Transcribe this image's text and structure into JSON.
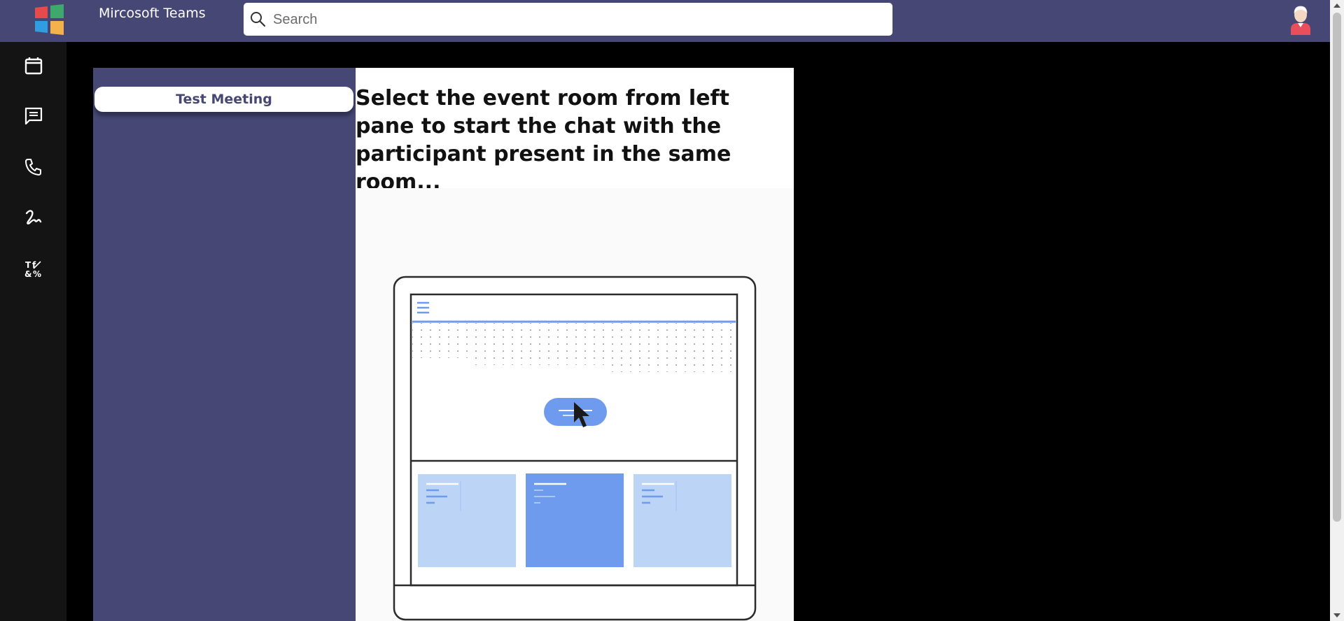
{
  "app": {
    "title": "Mircosoft Teams"
  },
  "search": {
    "placeholder": "Search",
    "value": ""
  },
  "rail": {
    "items": [
      {
        "icon": "calendar-icon"
      },
      {
        "icon": "chat-icon"
      },
      {
        "icon": "phone-icon"
      },
      {
        "icon": "signature-icon"
      },
      {
        "icon": "text-format-icon"
      }
    ]
  },
  "events": {
    "items": [
      {
        "label": "Test Meeting"
      }
    ]
  },
  "main": {
    "instruction": "Select the event room from left pane to start the chat with the participant present in the same room..."
  },
  "colors": {
    "brand": "#464775",
    "rail": "#141414",
    "illustration_blue": "#6f9bef",
    "illustration_light_blue": "#bcd4f6"
  }
}
